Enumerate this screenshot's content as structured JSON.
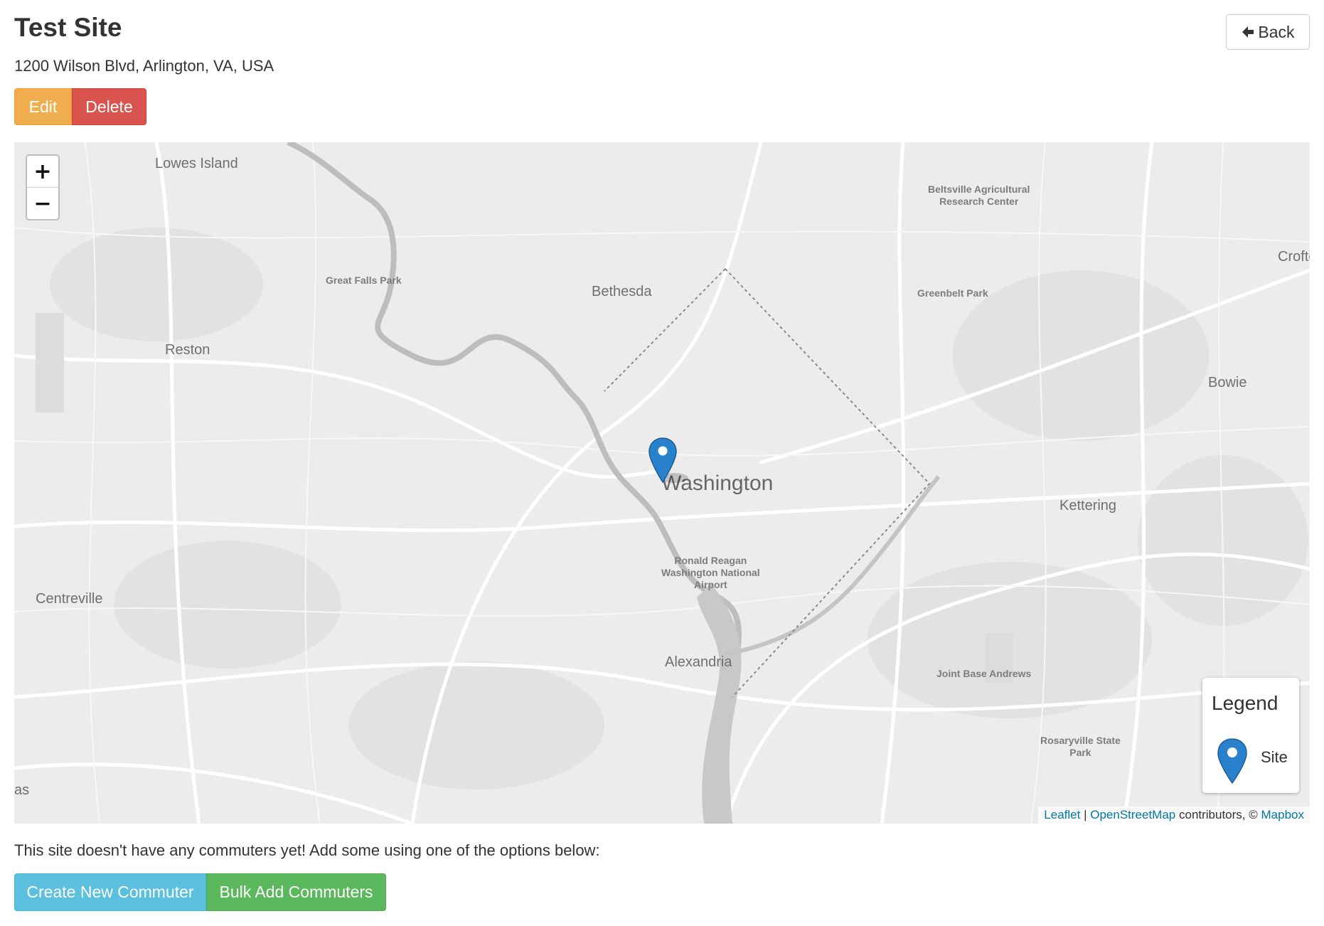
{
  "header": {
    "title": "Test Site",
    "address": "1200 Wilson Blvd, Arlington, VA, USA",
    "back_label": "Back",
    "edit_label": "Edit",
    "delete_label": "Delete"
  },
  "map": {
    "zoom_in": "+",
    "zoom_out": "−",
    "places": {
      "lowes_island": "Lowes Island",
      "great_falls": "Great Falls Park",
      "bethesda": "Bethesda",
      "reston": "Reston",
      "beltsville_1": "Beltsville Agricultural",
      "beltsville_2": "Research Center",
      "greenbelt": "Greenbelt Park",
      "crofton": "Crofto",
      "bowie": "Bowie",
      "washington": "Washington",
      "kettering": "Kettering",
      "reagan_1": "Ronald Reagan",
      "reagan_2": "Washington National",
      "reagan_3": "Airport",
      "centreville": "Centreville",
      "alexandria": "Alexandria",
      "andrews": "Joint Base Andrews",
      "rosaryville_1": "Rosaryville State",
      "rosaryville_2": "Park",
      "edge_as": "as"
    },
    "legend": {
      "title": "Legend",
      "site_label": "Site"
    },
    "attribution": {
      "leaflet": "Leaflet",
      "sep": "|",
      "osm": "OpenStreetMap",
      "contributors": "contributors, ©",
      "mapbox": "Mapbox"
    },
    "marker_color": "#2a81cb"
  },
  "commuters": {
    "message": "This site doesn't have any commuters yet! Add some using one of the options below:",
    "create_label": "Create New Commuter",
    "bulk_label": "Bulk Add Commuters"
  },
  "colors": {
    "warning": "#f0ad4e",
    "danger": "#d9534f",
    "info": "#5bc0de",
    "success": "#5cb85c",
    "link": "#0078a8"
  }
}
